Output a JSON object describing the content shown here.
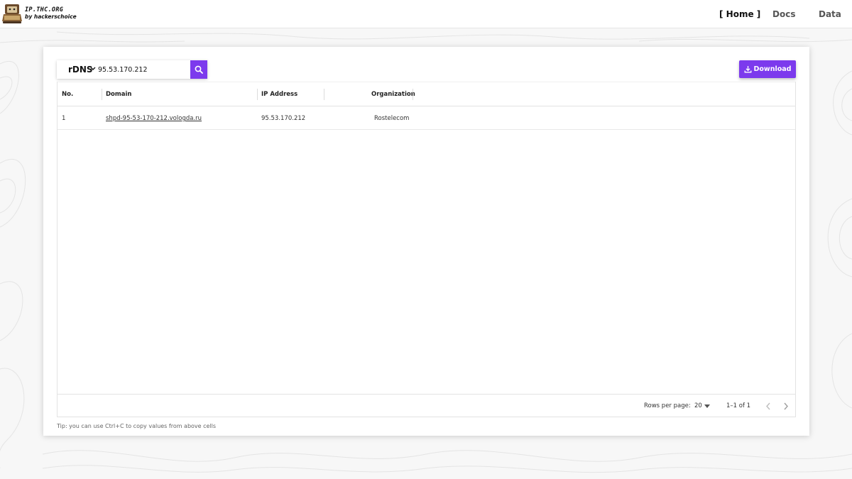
{
  "brand": {
    "name": "IP.THC.ORG",
    "sub": "by hackerschoice"
  },
  "nav": [
    {
      "label": "[ Home ]",
      "active": true
    },
    {
      "label": "Docs",
      "active": false
    },
    {
      "label": "Data",
      "active": false
    }
  ],
  "search": {
    "mode": "rDNS",
    "value": "95.53.170.212"
  },
  "download": {
    "label": "Download"
  },
  "table": {
    "columns": [
      "No.",
      "Domain",
      "IP Address",
      "Organization"
    ],
    "rows": [
      {
        "no": "1",
        "domain": "shpd-95-53-170-212.vologda.ru",
        "ip": "95.53.170.212",
        "org": "Rostelecom"
      }
    ]
  },
  "pagination": {
    "rows_per_page_label": "Rows per page:",
    "rows_per_page": "20",
    "range": "1–1 of 1"
  },
  "tip": "Tip: you can use Ctrl+C to copy values from above cells",
  "colors": {
    "accent": "#7c3aed",
    "background": "#f7f7f7"
  }
}
